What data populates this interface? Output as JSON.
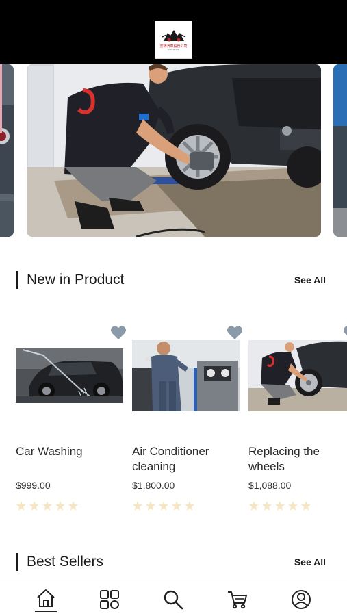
{
  "header": {
    "logo_text": "雲橋汽車股份公司",
    "logo_subtext": "Auto Service"
  },
  "new_in_product": {
    "title": "New in Product",
    "see_all_label": "See All",
    "products": [
      {
        "name": "Car Washing",
        "price": "$999.00",
        "rating": 0,
        "max_rating": 5,
        "favorite": false
      },
      {
        "name": "Air Conditioner cleaning",
        "price": "$1,800.00",
        "rating": 0,
        "max_rating": 5,
        "favorite": false
      },
      {
        "name": "Replacing the wheels",
        "price": "$1,088.00",
        "rating": 0,
        "max_rating": 5,
        "favorite": false
      }
    ]
  },
  "best_sellers": {
    "title": "Best Sellers",
    "see_all_label": "See All"
  },
  "bottom_nav": {
    "items": [
      "home-icon",
      "categories-icon",
      "search-icon",
      "cart-icon",
      "profile-icon"
    ],
    "active": "home-icon"
  },
  "colors": {
    "header_bg": "#000000",
    "heart": "#8a9aa8",
    "star_empty": "#f7e6c4",
    "accent": "#1a1a1a"
  }
}
